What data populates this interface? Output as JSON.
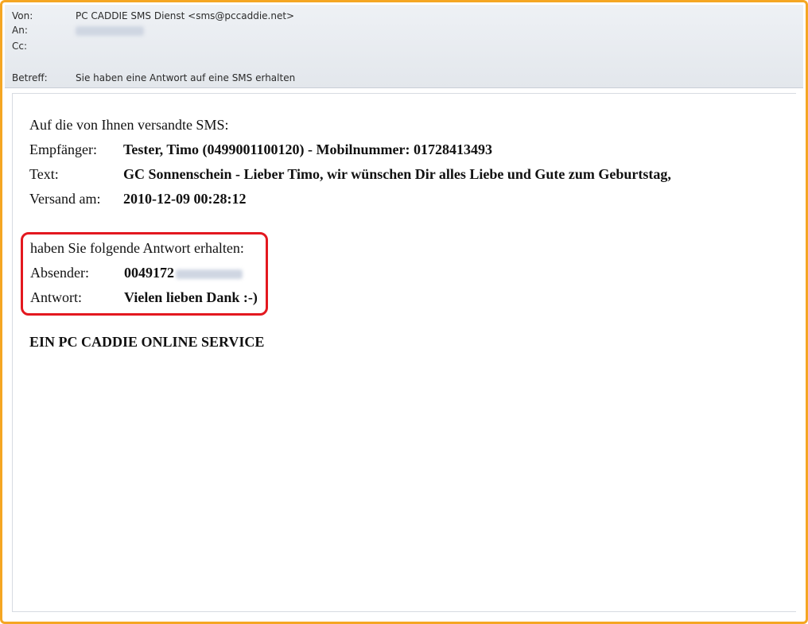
{
  "header": {
    "from_label": "Von:",
    "from_value": "PC CADDIE SMS Dienst <sms@pccaddie.net>",
    "to_label": "An:",
    "cc_label": "Cc:",
    "subject_label": "Betreff:",
    "subject_value": "Sie haben eine Antwort auf eine SMS erhalten"
  },
  "message": {
    "intro": "Auf die von Ihnen versandte SMS:",
    "recipient_label": "Empfänger:",
    "recipient_value": "Tester, Timo (0499001100120) - Mobilnummer: 01728413493",
    "text_label": "Text:",
    "text_value": "GC Sonnenschein - Lieber Timo, wir wünschen Dir alles Liebe und Gute zum Geburtstag,",
    "sent_label": "Versand am:",
    "sent_value": "2010-12-09 00:28:12",
    "reply_intro": "haben Sie folgende Antwort erhalten:",
    "sender_label": "Absender:",
    "sender_value": "0049172",
    "answer_label": "Antwort:",
    "answer_value": "Vielen lieben Dank :-)",
    "footer": "EIN PC CADDIE ONLINE SERVICE"
  },
  "colors": {
    "frame_border": "#f5a623",
    "highlight_border": "#e3181f"
  }
}
